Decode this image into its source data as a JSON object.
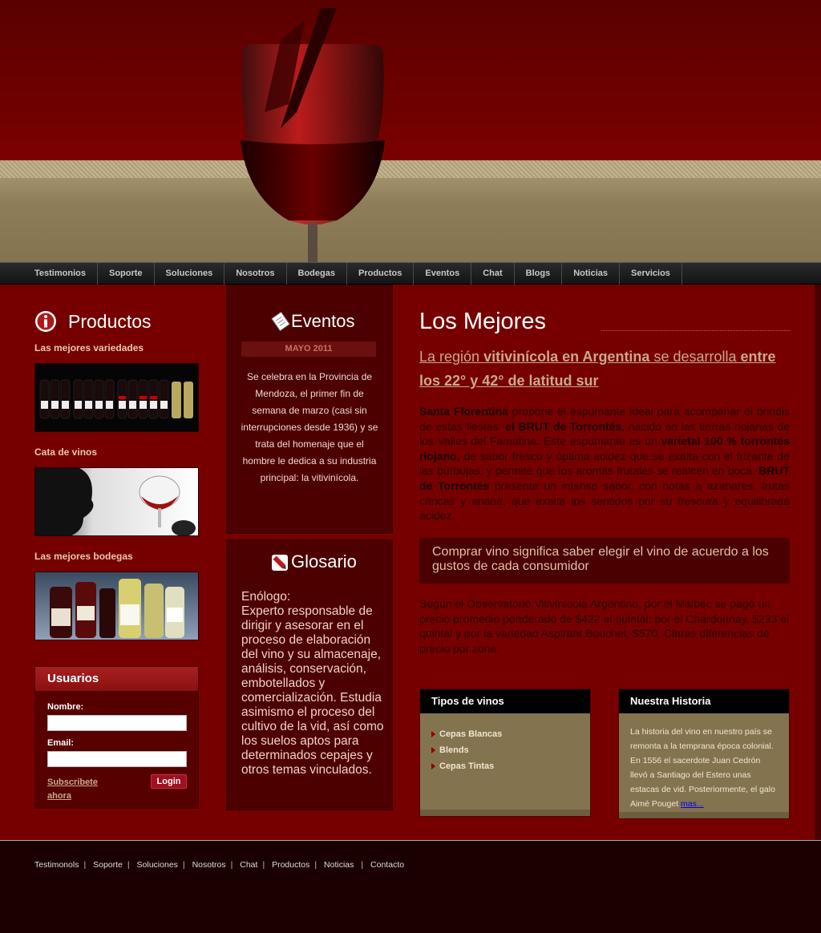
{
  "nav": [
    "Testimonios",
    "Soporte",
    "Soluciones",
    "Nosotros",
    "Bodegas",
    "Productos",
    "Eventos",
    "Chat",
    "Blogs",
    "Noticias",
    "Servicios"
  ],
  "left": {
    "title": "Productos",
    "sections": [
      "Las mejores variedades",
      "Cata de vinos",
      "Las mejores bodegas"
    ],
    "users": {
      "title": "Usuarios",
      "name_label": "Nombre:",
      "email_label": "Email:",
      "subscribe_line1": "Subscribete",
      "subscribe_line2": "ahora",
      "login": "Login"
    }
  },
  "events": {
    "title": "Eventos",
    "date": "MAYO 2011",
    "text": "Se celebra en la Provincia de Mendoza, el primer fin de semana de marzo (casi sin interrupciones desde 1936) y se trata del homenaje que el hombre le dedica a su industria principal: la vitivinícola."
  },
  "glossary": {
    "title": "Glosario",
    "term": "Enólogo:",
    "definition": "Experto responsable de dirigir y asesorar en el proceso de elaboración del vino y su almacenaje, análisis, conservación, embotellados y comercialización. Estudia asimismo el proceso del cultivo de la vid, así como los suelos aptos para determinados cepajes y otros temas vinculados."
  },
  "main": {
    "title": "Los Mejores",
    "lead": {
      "p1": "La región ",
      "b1": "vitivinícola en Argentina",
      "p2": " se desarrolla ",
      "b2": "entre los 22° y 42° de latitud sur"
    },
    "para": {
      "b1": "Santa Florentina",
      "t1": " propone el espumante ideal para acompañar el brindis de estas fiestas: ",
      "b2": "el BRUT de Torrontés",
      "t2": ", nacido en las tierras riojanas de los Valles del Famatina. Este espumante es un ",
      "b3": "varietal 100 % torrontés riojano",
      "t3": ", de sabor fresco y óptima acidez que se exalta con el frizante de las burbujas, y permite que los aromas frutales se realcen en boca. ",
      "b4": "BRUT de Torrontés",
      "t4": " presenta un intenso sabor, con notas a azahares, frutas cítricas y ananá, que exalta los sentidos por su frescura y equilibrada acidez."
    },
    "quote": "Comprar vino significa saber elegir el vino de acuerdo a los gustos de cada consumidor",
    "para2": "Según el Observatorio Vitivinícola Argentino, por el Malbec se pagó un precio promedio ponderado de $422 el quintal; por el Chardonnay, $233 el quintal y por la variedad Aspirant Bouchet, $570. Claras diferencias de precio por zona."
  },
  "tipos": {
    "title": "Tipos de vinos",
    "items": [
      "Cepas Blancas",
      "Blends",
      "Cepas Tintas"
    ]
  },
  "historia": {
    "title": "Nuestra Historia",
    "text": "La historia del vino en nuestro país se remonta a la temprana época colonial. En 1556 el sacerdote Juan Cedrón llevó a Santiago del Estero unas estacas de vid. Posteriormente, el galo Aimé Pouget ",
    "more": "mas..."
  },
  "footer": [
    "Testimonols",
    "Soporte",
    "Soluciones",
    "Nosotros",
    "Chat",
    "Productos",
    "Noticias",
    "Contacto"
  ],
  "colors": {
    "wine": "#760000",
    "dark_wine": "#4c0000",
    "tan": "#84734f",
    "nav": "#1e1e1e"
  }
}
